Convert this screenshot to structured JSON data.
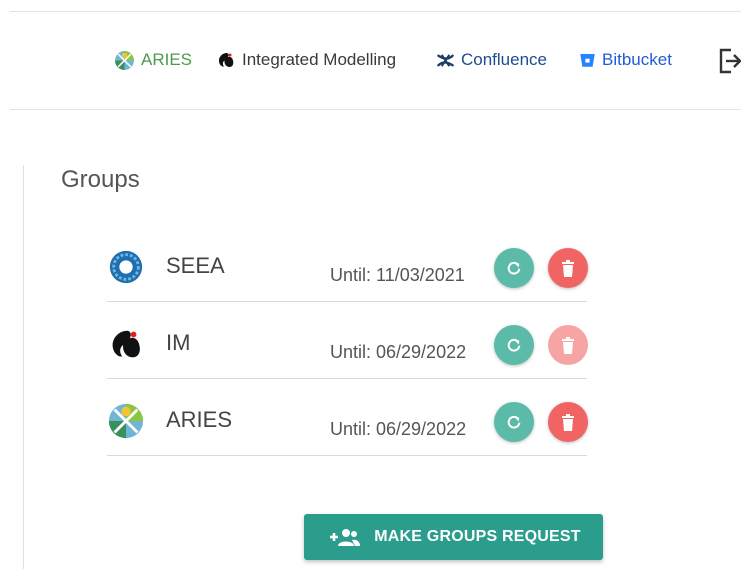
{
  "nav": {
    "links": [
      {
        "label": "ARIES",
        "icon": "aries-logo-icon",
        "color": "#4e9a48"
      },
      {
        "label": "Integrated Modelling",
        "icon": "im-logo-icon",
        "color": "#3a3a3a"
      },
      {
        "label": "Confluence",
        "icon": "confluence-icon",
        "color": "#1f4b8f"
      },
      {
        "label": "Bitbucket",
        "icon": "bitbucket-icon",
        "color": "#205cd8"
      }
    ],
    "logout_icon": "logout-icon"
  },
  "groups": {
    "title": "Groups",
    "rows": [
      {
        "name": "SEEA",
        "until": "Until: 11/03/2021",
        "logo": "seea-logo-icon",
        "delete_enabled": true
      },
      {
        "name": "IM",
        "until": "Until: 06/29/2022",
        "logo": "im-logo-icon",
        "delete_enabled": false
      },
      {
        "name": "ARIES",
        "until": "Until: 06/29/2022",
        "logo": "aries-logo-icon",
        "delete_enabled": true
      }
    ],
    "renew_icon": "refresh-icon",
    "delete_icon": "trash-icon"
  },
  "request_button": {
    "label": "MAKE GROUPS REQUEST",
    "icon": "add-group-icon"
  },
  "colors": {
    "teal_button": "#2a9d8c",
    "renew": "#5bbba8",
    "delete": "#f06464",
    "delete_disabled": "#f6a4a4"
  }
}
